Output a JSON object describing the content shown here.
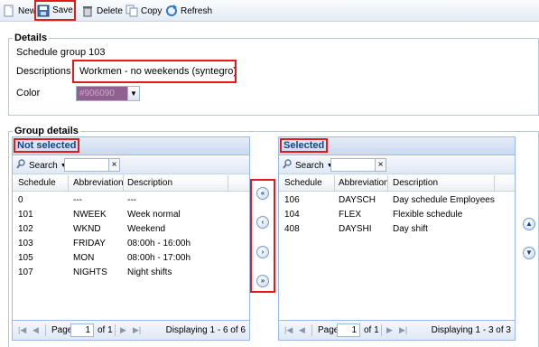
{
  "toolbar": {
    "new_label": "New",
    "save_label": "Save",
    "delete_label": "Delete",
    "copy_label": "Copy",
    "refresh_label": "Refresh"
  },
  "details": {
    "legend": "Details",
    "group_title": "Schedule group 103",
    "descriptions_label": "Descriptions",
    "descriptions_value": "Workmen - no weekends (syntegro)",
    "color_label": "Color",
    "color_value": "#906090"
  },
  "group_details": {
    "legend": "Group details"
  },
  "not_selected": {
    "title": "Not selected",
    "search_label": "Search",
    "columns": [
      "Schedule",
      "Abbreviation",
      "Description"
    ],
    "rows": [
      [
        "0",
        "---",
        "---"
      ],
      [
        "101",
        "NWEEK",
        "Week normal"
      ],
      [
        "102",
        "WKND",
        "Weekend"
      ],
      [
        "103",
        "FRIDAY",
        "08:00h - 16:00h"
      ],
      [
        "105",
        "MON",
        "08:00h - 17:00h"
      ],
      [
        "107",
        "NIGHTS",
        "Night shifts"
      ]
    ],
    "pager": {
      "page_label": "Page",
      "page_value": "1",
      "of_label": "of 1",
      "display": "Displaying 1 - 6 of 6"
    }
  },
  "selected": {
    "title": "Selected",
    "search_label": "Search",
    "columns": [
      "Schedule",
      "Abbreviation",
      "Description"
    ],
    "rows": [
      [
        "106",
        "DAYSCH",
        "Day schedule Employees"
      ],
      [
        "104",
        "FLEX",
        "Flexible schedule"
      ],
      [
        "408",
        "DAYSHI",
        "Day shift"
      ]
    ],
    "pager": {
      "page_label": "Page",
      "page_value": "1",
      "of_label": "of 1",
      "display": "Displaying 1 - 3 of 3"
    }
  },
  "move_buttons": {
    "all_left": "«",
    "left": "‹",
    "right": "›",
    "all_right": "»",
    "up": "▲",
    "down": "▼"
  },
  "icons": [
    "new-icon",
    "save-icon",
    "delete-icon",
    "copy-icon",
    "refresh-icon",
    "search-icon",
    "clear-icon",
    "dropdown-arrow-icon"
  ],
  "colors": {
    "accent_title": "#15428b",
    "panel_border": "#99bbe8",
    "highlight": "#e11a1a"
  }
}
